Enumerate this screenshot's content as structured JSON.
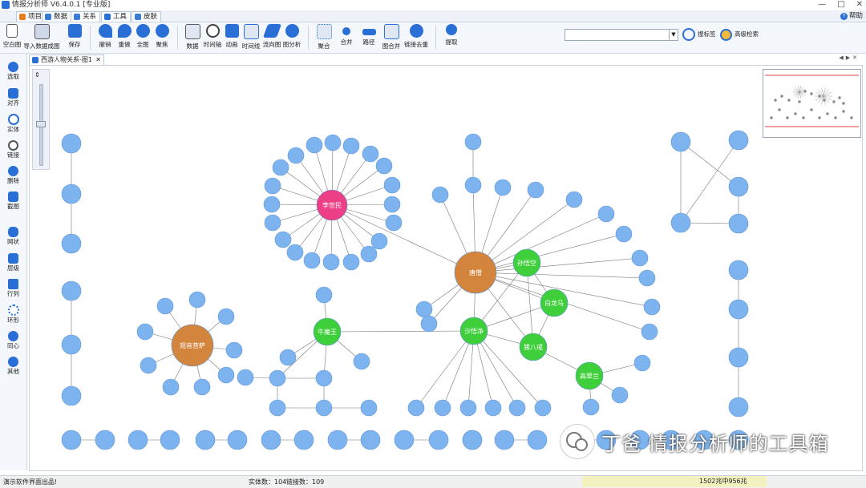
{
  "app": {
    "title": "情报分析师 V6.4.0.1 [专业版]",
    "window_buttons": [
      "—",
      "□",
      "✕"
    ]
  },
  "menu": {
    "tabs": [
      {
        "label": "项目",
        "color": "#e67e22"
      },
      {
        "label": "数据",
        "color": "#3a7bd5"
      },
      {
        "label": "关系",
        "color": "#3a7bd5"
      },
      {
        "label": "工具",
        "color": "#2a6fd6"
      },
      {
        "label": "皮肤",
        "color": "#3a7bd5"
      }
    ],
    "help": "帮助"
  },
  "toolbar": {
    "groups": [
      [
        {
          "label": "空白图",
          "icon": "blank-chart-icon"
        },
        {
          "label": "导入数据成图",
          "icon": "import-icon"
        },
        {
          "label": "保存",
          "icon": "save-icon"
        }
      ],
      [
        {
          "label": "撤销",
          "icon": "undo-icon"
        },
        {
          "label": "重做",
          "icon": "redo-icon"
        },
        {
          "label": "全图",
          "icon": "fit-icon"
        },
        {
          "label": "聚焦",
          "icon": "focus-icon"
        }
      ],
      [
        {
          "label": "数据",
          "icon": "table-icon"
        },
        {
          "label": "时间轴",
          "icon": "clock-icon"
        },
        {
          "label": "动画",
          "icon": "play-icon"
        },
        {
          "label": "时间线",
          "icon": "timeline-icon"
        },
        {
          "label": "流向图",
          "icon": "flow-icon"
        },
        {
          "label": "图分析",
          "icon": "graph-analysis-icon"
        }
      ],
      [
        {
          "label": "聚合",
          "icon": "aggregate-icon"
        },
        {
          "label": "合并",
          "icon": "merge-icon"
        },
        {
          "label": "路径",
          "icon": "path-icon"
        },
        {
          "label": "图合并",
          "icon": "chart-merge-icon"
        },
        {
          "label": "链接去重",
          "icon": "link-dedupe-icon"
        }
      ],
      [
        {
          "label": "提取",
          "icon": "extract-icon"
        }
      ]
    ],
    "search_placeholder": "",
    "search_label": "搜标签",
    "advanced_label": "高级检索"
  },
  "sidebar": [
    {
      "label": "选取",
      "icon": "select-icon"
    },
    {
      "label": "对齐",
      "icon": "align-icon"
    },
    {
      "label": "实体",
      "icon": "entity-icon"
    },
    {
      "label": "链接",
      "icon": "link-icon"
    },
    {
      "label": "删除",
      "icon": "delete-icon"
    },
    {
      "label": "截图",
      "icon": "screenshot-icon"
    },
    {
      "label": "网状",
      "icon": "network-layout-icon"
    },
    {
      "label": "层级",
      "icon": "hierarchy-icon"
    },
    {
      "label": "行列",
      "icon": "grid-layout-icon"
    },
    {
      "label": "环形",
      "icon": "circle-layout-icon"
    },
    {
      "label": "同心",
      "icon": "concentric-icon"
    },
    {
      "label": "其他",
      "icon": "other-layout-icon"
    }
  ],
  "document_tab": {
    "label": "西游人物关系-图1"
  },
  "graph": {
    "colors": {
      "node": "#7db4f0",
      "node_stroke": "#5d95d6",
      "hub_pink": "#ec3f86",
      "hub_orange": "#d3853d",
      "hub_green": "#3fcf3a",
      "edge": "#777777"
    },
    "hubs": [
      {
        "id": "lsm",
        "label": "李世民",
        "color": "#ec3f86"
      },
      {
        "id": "ts",
        "label": "唐僧",
        "color": "#d3853d"
      },
      {
        "id": "gysp",
        "label": "观音菩萨",
        "color": "#d3853d"
      },
      {
        "id": "ssj",
        "label": "沙悟净",
        "color": "#3fcf3a"
      },
      {
        "id": "swk",
        "label": "孙悟空",
        "color": "#3fcf3a"
      },
      {
        "id": "blm",
        "label": "白龙马",
        "color": "#3fcf3a"
      },
      {
        "id": "zbj",
        "label": "猪八戒",
        "color": "#3fcf3a"
      },
      {
        "id": "nmw",
        "label": "牛魔王",
        "color": "#3fcf3a"
      },
      {
        "id": "gcl",
        "label": "高翠兰",
        "color": "#3fcf3a"
      }
    ]
  },
  "status": {
    "left": "演示软件界面出品!",
    "entity_count": "实体数：104",
    "link_count": "链接数：109",
    "memory": "1502兆中956兆"
  },
  "watermark": "丁爸 情报分析师的工具箱"
}
